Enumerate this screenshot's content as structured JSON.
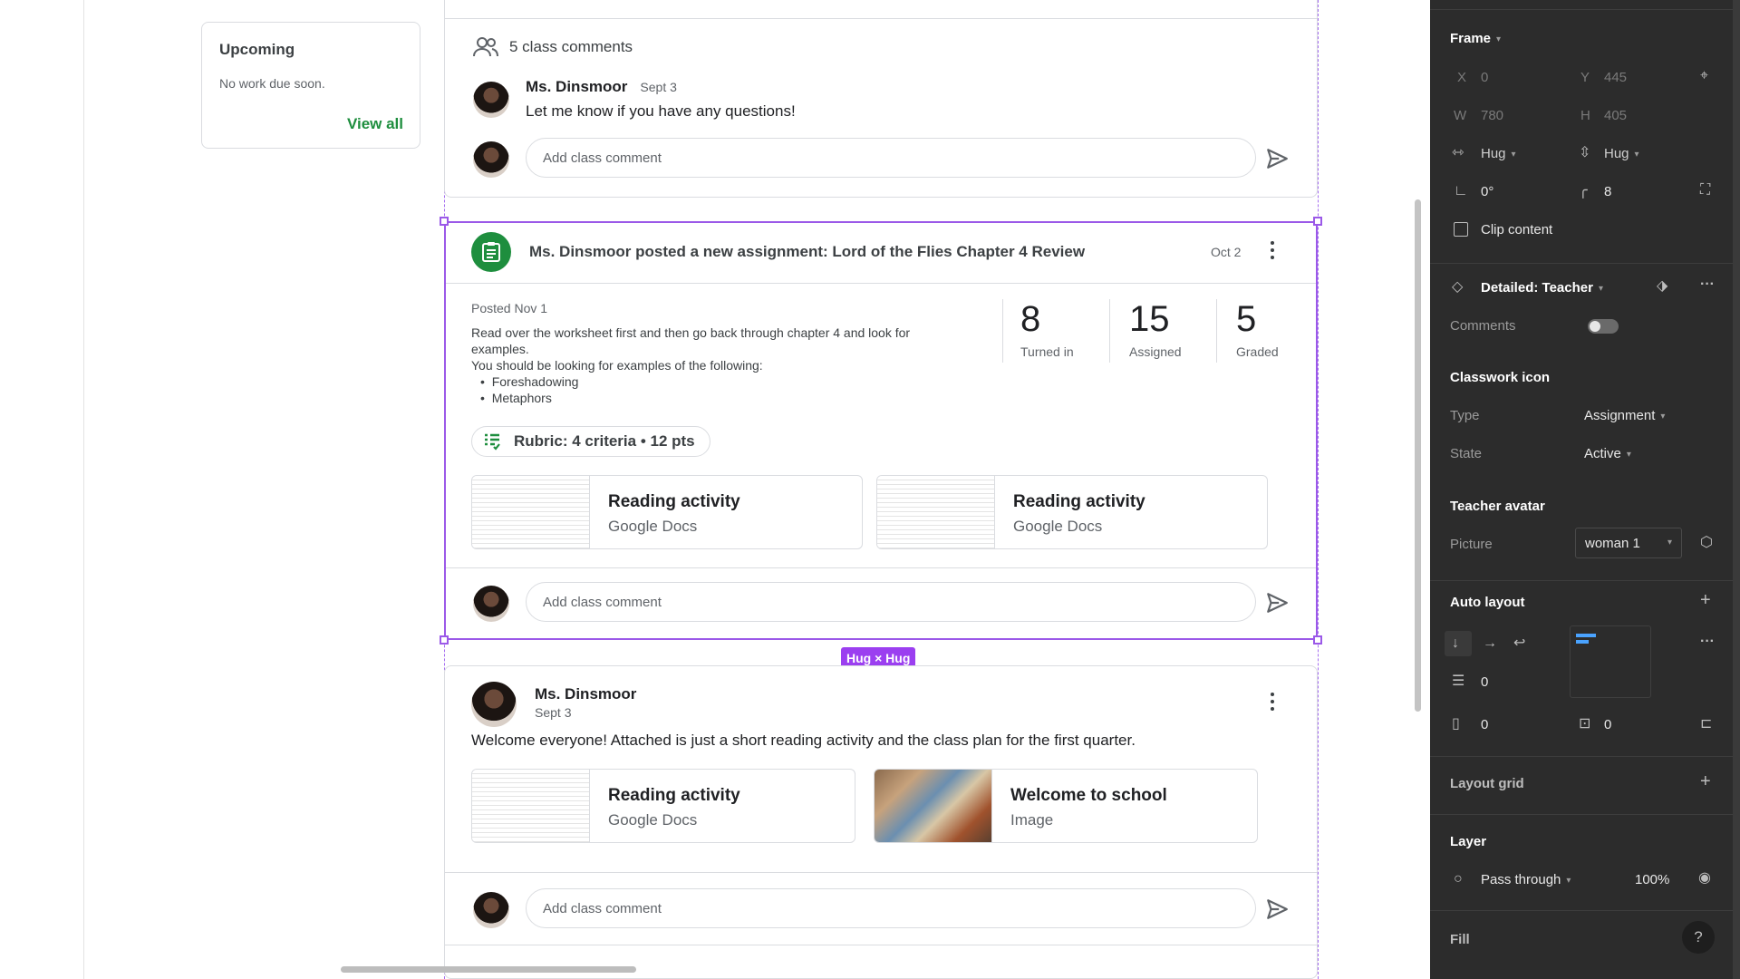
{
  "upcoming": {
    "title": "Upcoming",
    "subtitle": "No work due soon.",
    "link": "View all"
  },
  "comments_summary": {
    "label": "5 class comments"
  },
  "post1": {
    "author": "Ms. Dinsmoor",
    "date": "Sept 3",
    "text": "Let me know if you have any questions!"
  },
  "comment_placeholder": "Add class comment",
  "assignment": {
    "title": "Ms. Dinsmoor posted a new assignment: Lord of the Flies Chapter 4 Review",
    "date": "Oct 2",
    "posted": "Posted Nov 1",
    "desc_line1": "Read over the worksheet first and then go back through chapter 4 and look for",
    "desc_line2": "examples.",
    "desc_line3": "You should be looking for examples of the following:",
    "bullets": [
      "Foreshadowing",
      "Metaphors"
    ],
    "stats": [
      {
        "num": "8",
        "label": "Turned in"
      },
      {
        "num": "15",
        "label": "Assigned"
      },
      {
        "num": "5",
        "label": "Graded"
      }
    ],
    "rubric": "Rubric: 4 criteria • 12 pts",
    "attachments": [
      {
        "title": "Reading activity",
        "subtitle": "Google Docs"
      },
      {
        "title": "Reading activity",
        "subtitle": "Google Docs"
      }
    ]
  },
  "hug_label": "Hug × Hug",
  "post2": {
    "author": "Ms. Dinsmoor",
    "date": "Sept 3",
    "text": "Welcome everyone! Attached is just a short reading activity and the class plan for the first quarter.",
    "attachments": [
      {
        "title": "Reading activity",
        "subtitle": "Google Docs"
      },
      {
        "title": "Welcome to school",
        "subtitle": "Image"
      }
    ]
  },
  "panel": {
    "frame": "Frame",
    "x_label": "X",
    "x_val": "0",
    "y_label": "Y",
    "y_val": "445",
    "w_label": "W",
    "w_val": "780",
    "h_label": "H",
    "h_val": "405",
    "hug_w": "Hug",
    "hug_h": "Hug",
    "rotation": "0°",
    "radius": "8",
    "clip": "Clip content",
    "component": "Detailed: Teacher",
    "comments": "Comments",
    "classwork_icon": "Classwork icon",
    "type_label": "Type",
    "type_val": "Assignment",
    "state_label": "State",
    "state_val": "Active",
    "teacher_avatar": "Teacher avatar",
    "picture_label": "Picture",
    "picture_val": "woman 1",
    "auto_layout": "Auto layout",
    "gap": "0",
    "pad_h": "0",
    "pad_v": "0",
    "layout_grid": "Layout grid",
    "layer": "Layer",
    "blend": "Pass through",
    "opacity": "100%",
    "fill": "Fill",
    "help": "?"
  },
  "colors": {
    "accent_green": "#1e8e3e",
    "selection": "#9b59e8",
    "panel_bg": "#2c2c2c"
  }
}
